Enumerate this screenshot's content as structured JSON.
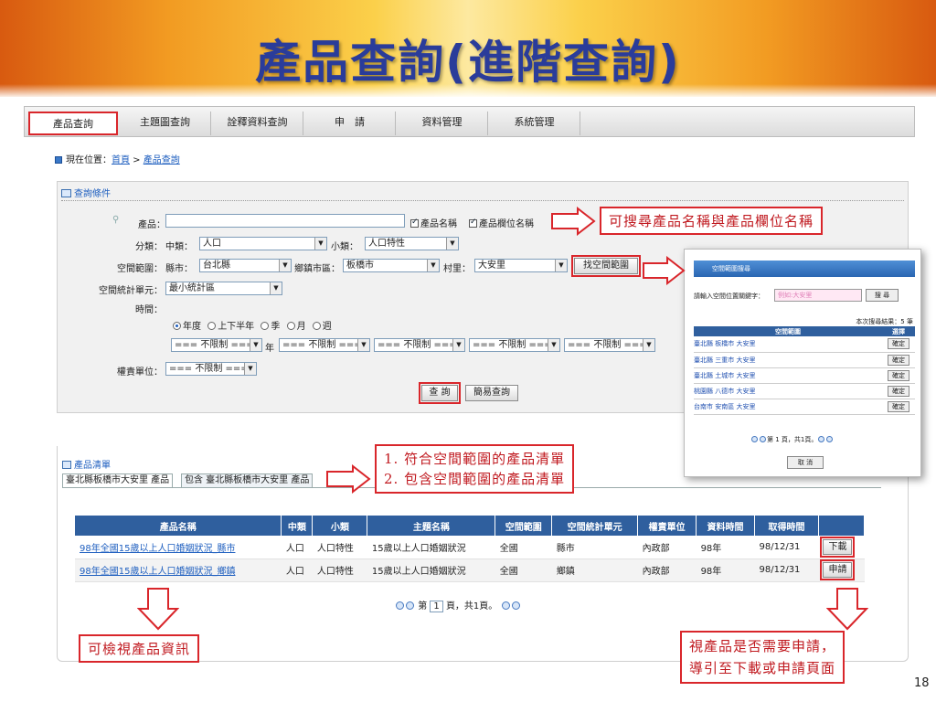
{
  "slide_title": "產品查詢(進階查詢)",
  "page_number": "18",
  "nav": {
    "tabs": [
      "產品查詢",
      "主題圖查詢",
      "詮釋資料查詢",
      "申　請",
      "資料管理",
      "系統管理"
    ],
    "active_index": 0
  },
  "breadcrumb": {
    "prefix": "現在位置：",
    "home": "首頁",
    "sep": " > ",
    "current": "產品查詢"
  },
  "query": {
    "title": "查詢條件",
    "product_label": "產品：",
    "check_name": "產品名稱",
    "check_field": "產品欄位名稱",
    "category_label": "分類：",
    "major_label": "中類：",
    "major_value": "人口",
    "minor_label": "小類：",
    "minor_value": "人口特性",
    "space_label": "空間範圍：",
    "county_label": "縣市：",
    "county_value": "台北縣",
    "town_label": "鄉鎮市區：",
    "town_value": "板橋市",
    "village_label": "村里：",
    "village_value": "大安里",
    "find_space_button": "找空間範圍",
    "unit_label": "空間統計單元：",
    "unit_value": "最小統計區",
    "time_label": "時間：",
    "time_options": [
      "年度",
      "上下半年",
      "季",
      "月",
      "週"
    ],
    "unlimited": "=== 不限制 ===",
    "year_label": "年",
    "authority_label": "權責單位：",
    "query_button": "查 詢",
    "simple_button": "簡易查詢"
  },
  "popup": {
    "title": "空間範圍搜尋",
    "prompt": "請輸入空間位置關鍵字：",
    "placeholder": "例如:大安里",
    "search_button": "搜 尋",
    "result_count": "本次搜尋結果：5 筆",
    "col_range": "空間範圍",
    "col_select": "選擇",
    "rows": [
      "臺北縣 板橋市 大安里",
      "臺北縣 三重市 大安里",
      "臺北縣 土城市 大安里",
      "桃園縣 八德市 大安里",
      "台南市 安南區 大安里"
    ],
    "confirm": "確定",
    "pager": "第 1 頁，共1頁。",
    "cancel_button": "取 消"
  },
  "list": {
    "title": "產品清單",
    "tabs": [
      "臺北縣板橋市大安里 產品",
      "包含 臺北縣板橋市大安里 產品"
    ],
    "columns": [
      "產品名稱",
      "中類",
      "小類",
      "主題名稱",
      "空間範圍",
      "空間統計單元",
      "權責單位",
      "資料時間",
      "取得時間",
      ""
    ],
    "rows": [
      [
        "98年全國15歲以上人口婚姻狀況_縣市",
        "人口",
        "人口特性",
        "15歲以上人口婚姻狀況",
        "全國",
        "縣市",
        "內政部",
        "98年",
        "98/12/31",
        "下載"
      ],
      [
        "98年全國15歲以上人口婚姻狀況_鄉鎮",
        "人口",
        "人口特性",
        "15歲以上人口婚姻狀況",
        "全國",
        "鄉鎮",
        "內政部",
        "98年",
        "98/12/31",
        "申請"
      ]
    ],
    "pager_pre": "第",
    "pager_page": "1",
    "pager_post": "頁，共1頁。"
  },
  "callouts": {
    "search": "可搜尋產品名稱與產品欄位名稱",
    "list_line1": "1. 符合空間範圍的產品清單",
    "list_line2": "2. 包含空間範圍的產品清單",
    "inspect": "可檢視產品資訊",
    "apply_line1": "視產品是否需要申請，",
    "apply_line2": "導引至下載或申請頁面"
  },
  "colors": {
    "title": "#2a3c9a",
    "accent_red": "#d9262b",
    "table_header": "#2f5f9e",
    "link": "#2060c0"
  }
}
